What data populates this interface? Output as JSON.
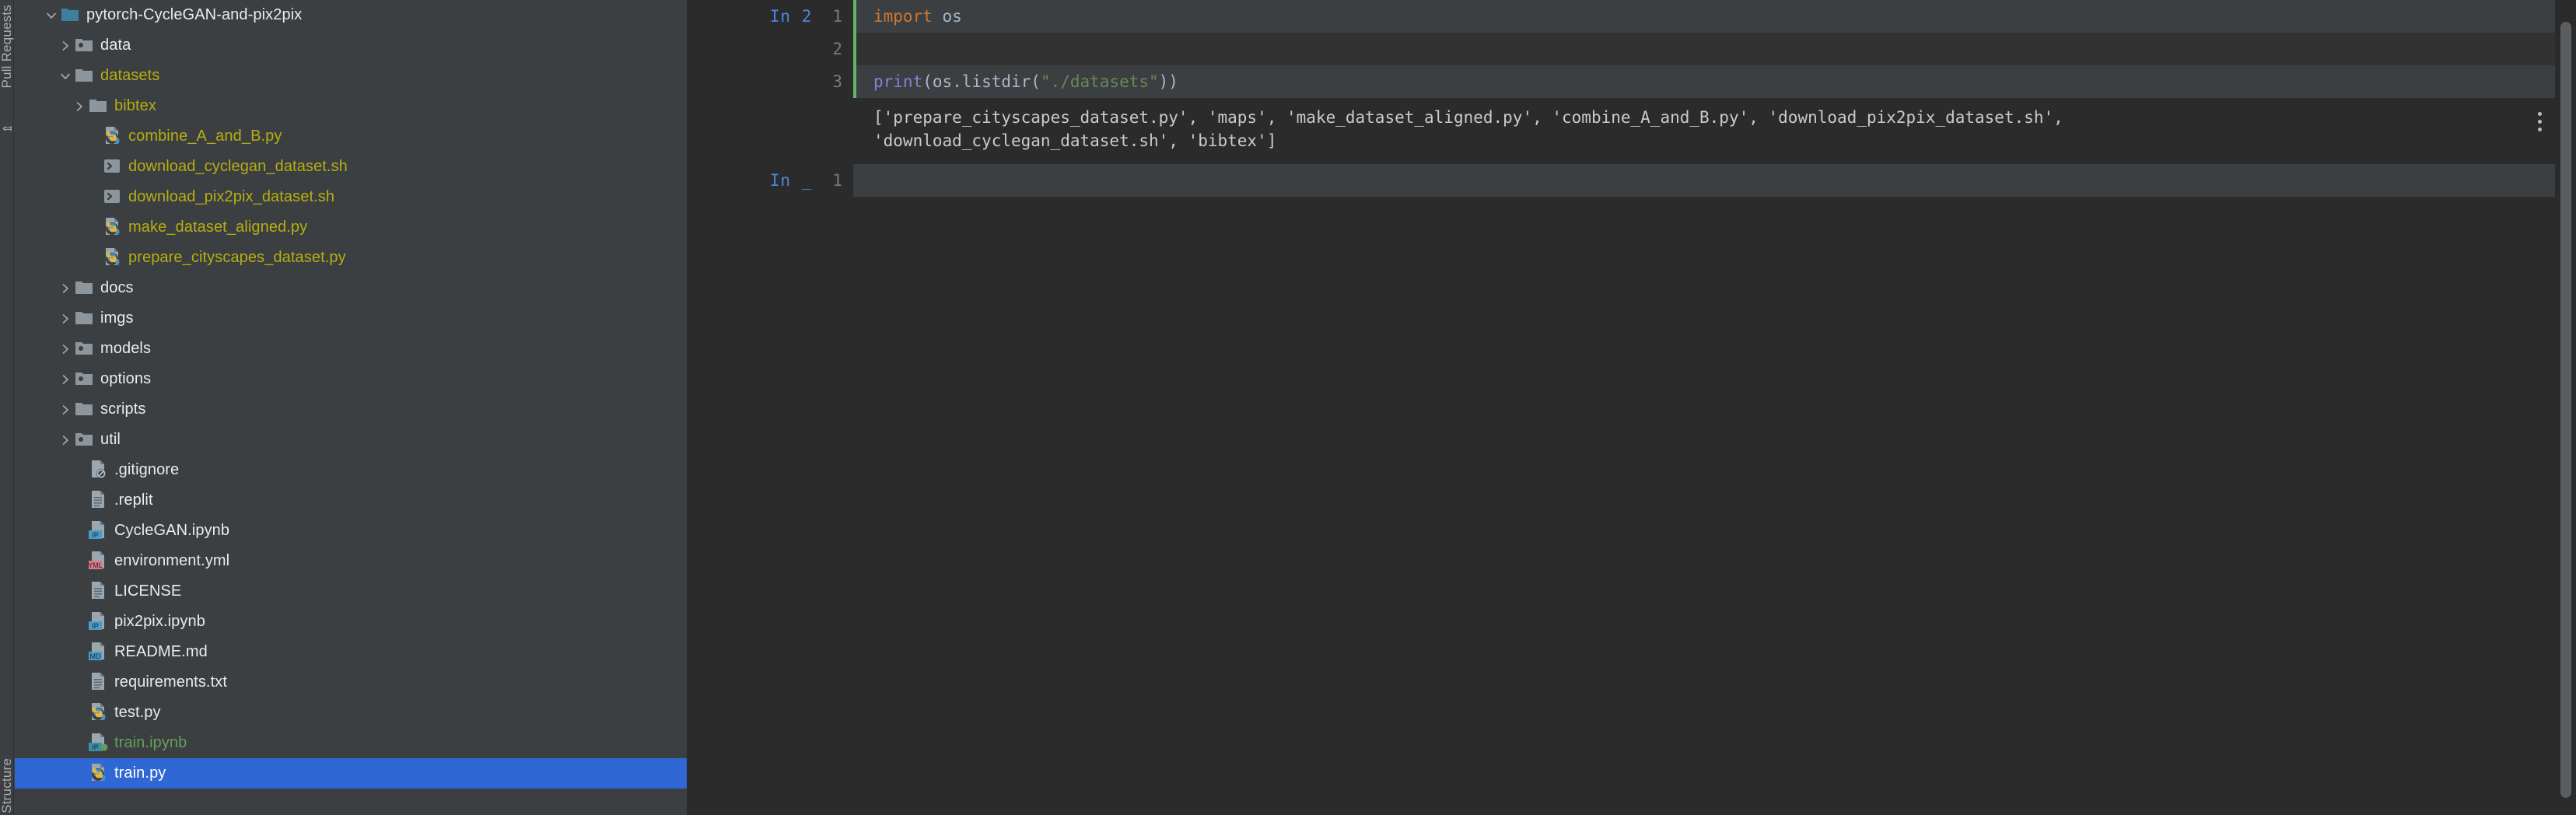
{
  "toolwindows": {
    "left_top_label": "Pull Requests",
    "left_bottom_label": "Structure",
    "collapse_icon": "arrow-left-icon"
  },
  "project_tree": {
    "name": "project-file-tree",
    "items": [
      {
        "label": "pytorch-CycleGAN-and-pix2pix",
        "indent": 0,
        "chevron": "down",
        "icon": "folder-module-icon",
        "color": "white",
        "selected": false
      },
      {
        "label": "data",
        "indent": 1,
        "chevron": "right",
        "icon": "folder-package-icon",
        "color": "white",
        "selected": false
      },
      {
        "label": "datasets",
        "indent": 1,
        "chevron": "down",
        "icon": "folder-icon",
        "color": "yellow",
        "selected": false
      },
      {
        "label": "bibtex",
        "indent": 2,
        "chevron": "right",
        "icon": "folder-icon",
        "color": "yellow",
        "selected": false
      },
      {
        "label": "combine_A_and_B.py",
        "indent": 3,
        "chevron": "none",
        "icon": "python-file-icon",
        "color": "yellow",
        "selected": false
      },
      {
        "label": "download_cyclegan_dataset.sh",
        "indent": 3,
        "chevron": "none",
        "icon": "shell-script-icon",
        "color": "yellow",
        "selected": false
      },
      {
        "label": "download_pix2pix_dataset.sh",
        "indent": 3,
        "chevron": "none",
        "icon": "shell-script-icon",
        "color": "yellow",
        "selected": false
      },
      {
        "label": "make_dataset_aligned.py",
        "indent": 3,
        "chevron": "none",
        "icon": "python-file-icon",
        "color": "yellow",
        "selected": false
      },
      {
        "label": "prepare_cityscapes_dataset.py",
        "indent": 3,
        "chevron": "none",
        "icon": "python-file-icon",
        "color": "yellow",
        "selected": false
      },
      {
        "label": "docs",
        "indent": 1,
        "chevron": "right",
        "icon": "folder-icon",
        "color": "white",
        "selected": false
      },
      {
        "label": "imgs",
        "indent": 1,
        "chevron": "right",
        "icon": "folder-icon",
        "color": "white",
        "selected": false
      },
      {
        "label": "models",
        "indent": 1,
        "chevron": "right",
        "icon": "folder-package-icon",
        "color": "white",
        "selected": false
      },
      {
        "label": "options",
        "indent": 1,
        "chevron": "right",
        "icon": "folder-package-icon",
        "color": "white",
        "selected": false
      },
      {
        "label": "scripts",
        "indent": 1,
        "chevron": "right",
        "icon": "folder-icon",
        "color": "white",
        "selected": false
      },
      {
        "label": "util",
        "indent": 1,
        "chevron": "right",
        "icon": "folder-package-icon",
        "color": "white",
        "selected": false
      },
      {
        "label": ".gitignore",
        "indent": 2,
        "chevron": "none",
        "icon": "gitignore-file-icon",
        "color": "white",
        "selected": false
      },
      {
        "label": ".replit",
        "indent": 2,
        "chevron": "none",
        "icon": "text-file-icon",
        "color": "white",
        "selected": false
      },
      {
        "label": "CycleGAN.ipynb",
        "indent": 2,
        "chevron": "none",
        "icon": "ipynb-file-icon",
        "color": "white",
        "selected": false
      },
      {
        "label": "environment.yml",
        "indent": 2,
        "chevron": "none",
        "icon": "yml-file-icon",
        "color": "white",
        "selected": false
      },
      {
        "label": "LICENSE",
        "indent": 2,
        "chevron": "none",
        "icon": "text-file-icon",
        "color": "white",
        "selected": false
      },
      {
        "label": "pix2pix.ipynb",
        "indent": 2,
        "chevron": "none",
        "icon": "ipynb-file-icon",
        "color": "white",
        "selected": false
      },
      {
        "label": "README.md",
        "indent": 2,
        "chevron": "none",
        "icon": "markdown-file-icon",
        "color": "white",
        "selected": false
      },
      {
        "label": "requirements.txt",
        "indent": 2,
        "chevron": "none",
        "icon": "text-file-icon",
        "color": "white",
        "selected": false
      },
      {
        "label": "test.py",
        "indent": 2,
        "chevron": "none",
        "icon": "python-file-icon",
        "color": "white",
        "selected": false
      },
      {
        "label": "train.ipynb",
        "indent": 2,
        "chevron": "none",
        "icon": "ipynb-file-modified-icon",
        "color": "green",
        "selected": false
      },
      {
        "label": "train.py",
        "indent": 2,
        "chevron": "none",
        "icon": "python-file-icon",
        "color": "white",
        "selected": true
      }
    ]
  },
  "notebook": {
    "name": "jupyter-notebook-editor",
    "run_status_icon": "green-check-icon",
    "cells": [
      {
        "prompt": "In 2",
        "active": true,
        "lines": [
          {
            "no": "1",
            "shaded": true,
            "tokens": [
              {
                "t": "import",
                "c": "kw-import"
              },
              {
                "t": " os",
                "c": "id-plain"
              }
            ]
          },
          {
            "no": "2",
            "shaded": false,
            "tokens": []
          },
          {
            "no": "3",
            "shaded": true,
            "tokens": [
              {
                "t": "print",
                "c": "fn-print"
              },
              {
                "t": "(os.listdir(",
                "c": "punct"
              },
              {
                "t": "\"./datasets\"",
                "c": "str-green"
              },
              {
                "t": "))",
                "c": "punct"
              }
            ]
          }
        ],
        "output": {
          "menu_icon": "more-vertical-icon",
          "lines": [
            "['prepare_cityscapes_dataset.py', 'maps', 'make_dataset_aligned.py', 'combine_A_and_B.py', 'download_pix2pix_dataset.sh',",
            "'download_cyclegan_dataset.sh', 'bibtex']"
          ]
        }
      },
      {
        "prompt": "In _",
        "active": false,
        "lines": [
          {
            "no": "1",
            "shaded": true,
            "tokens": []
          }
        ],
        "output": null
      }
    ]
  },
  "colors": {
    "background": "#3c3f41",
    "editor_background": "#2b2b2b",
    "selection_blue": "#2f68d4",
    "file_yellow": "#b5ae11",
    "modified_green": "#62a05a",
    "cell_active_border": "#63b463",
    "prompt_blue": "#4a88df",
    "keyword_orange": "#cc7832",
    "function_purple": "#8a7fd6",
    "string_green": "#6a8759",
    "scrollbar": "#5a5e60"
  }
}
